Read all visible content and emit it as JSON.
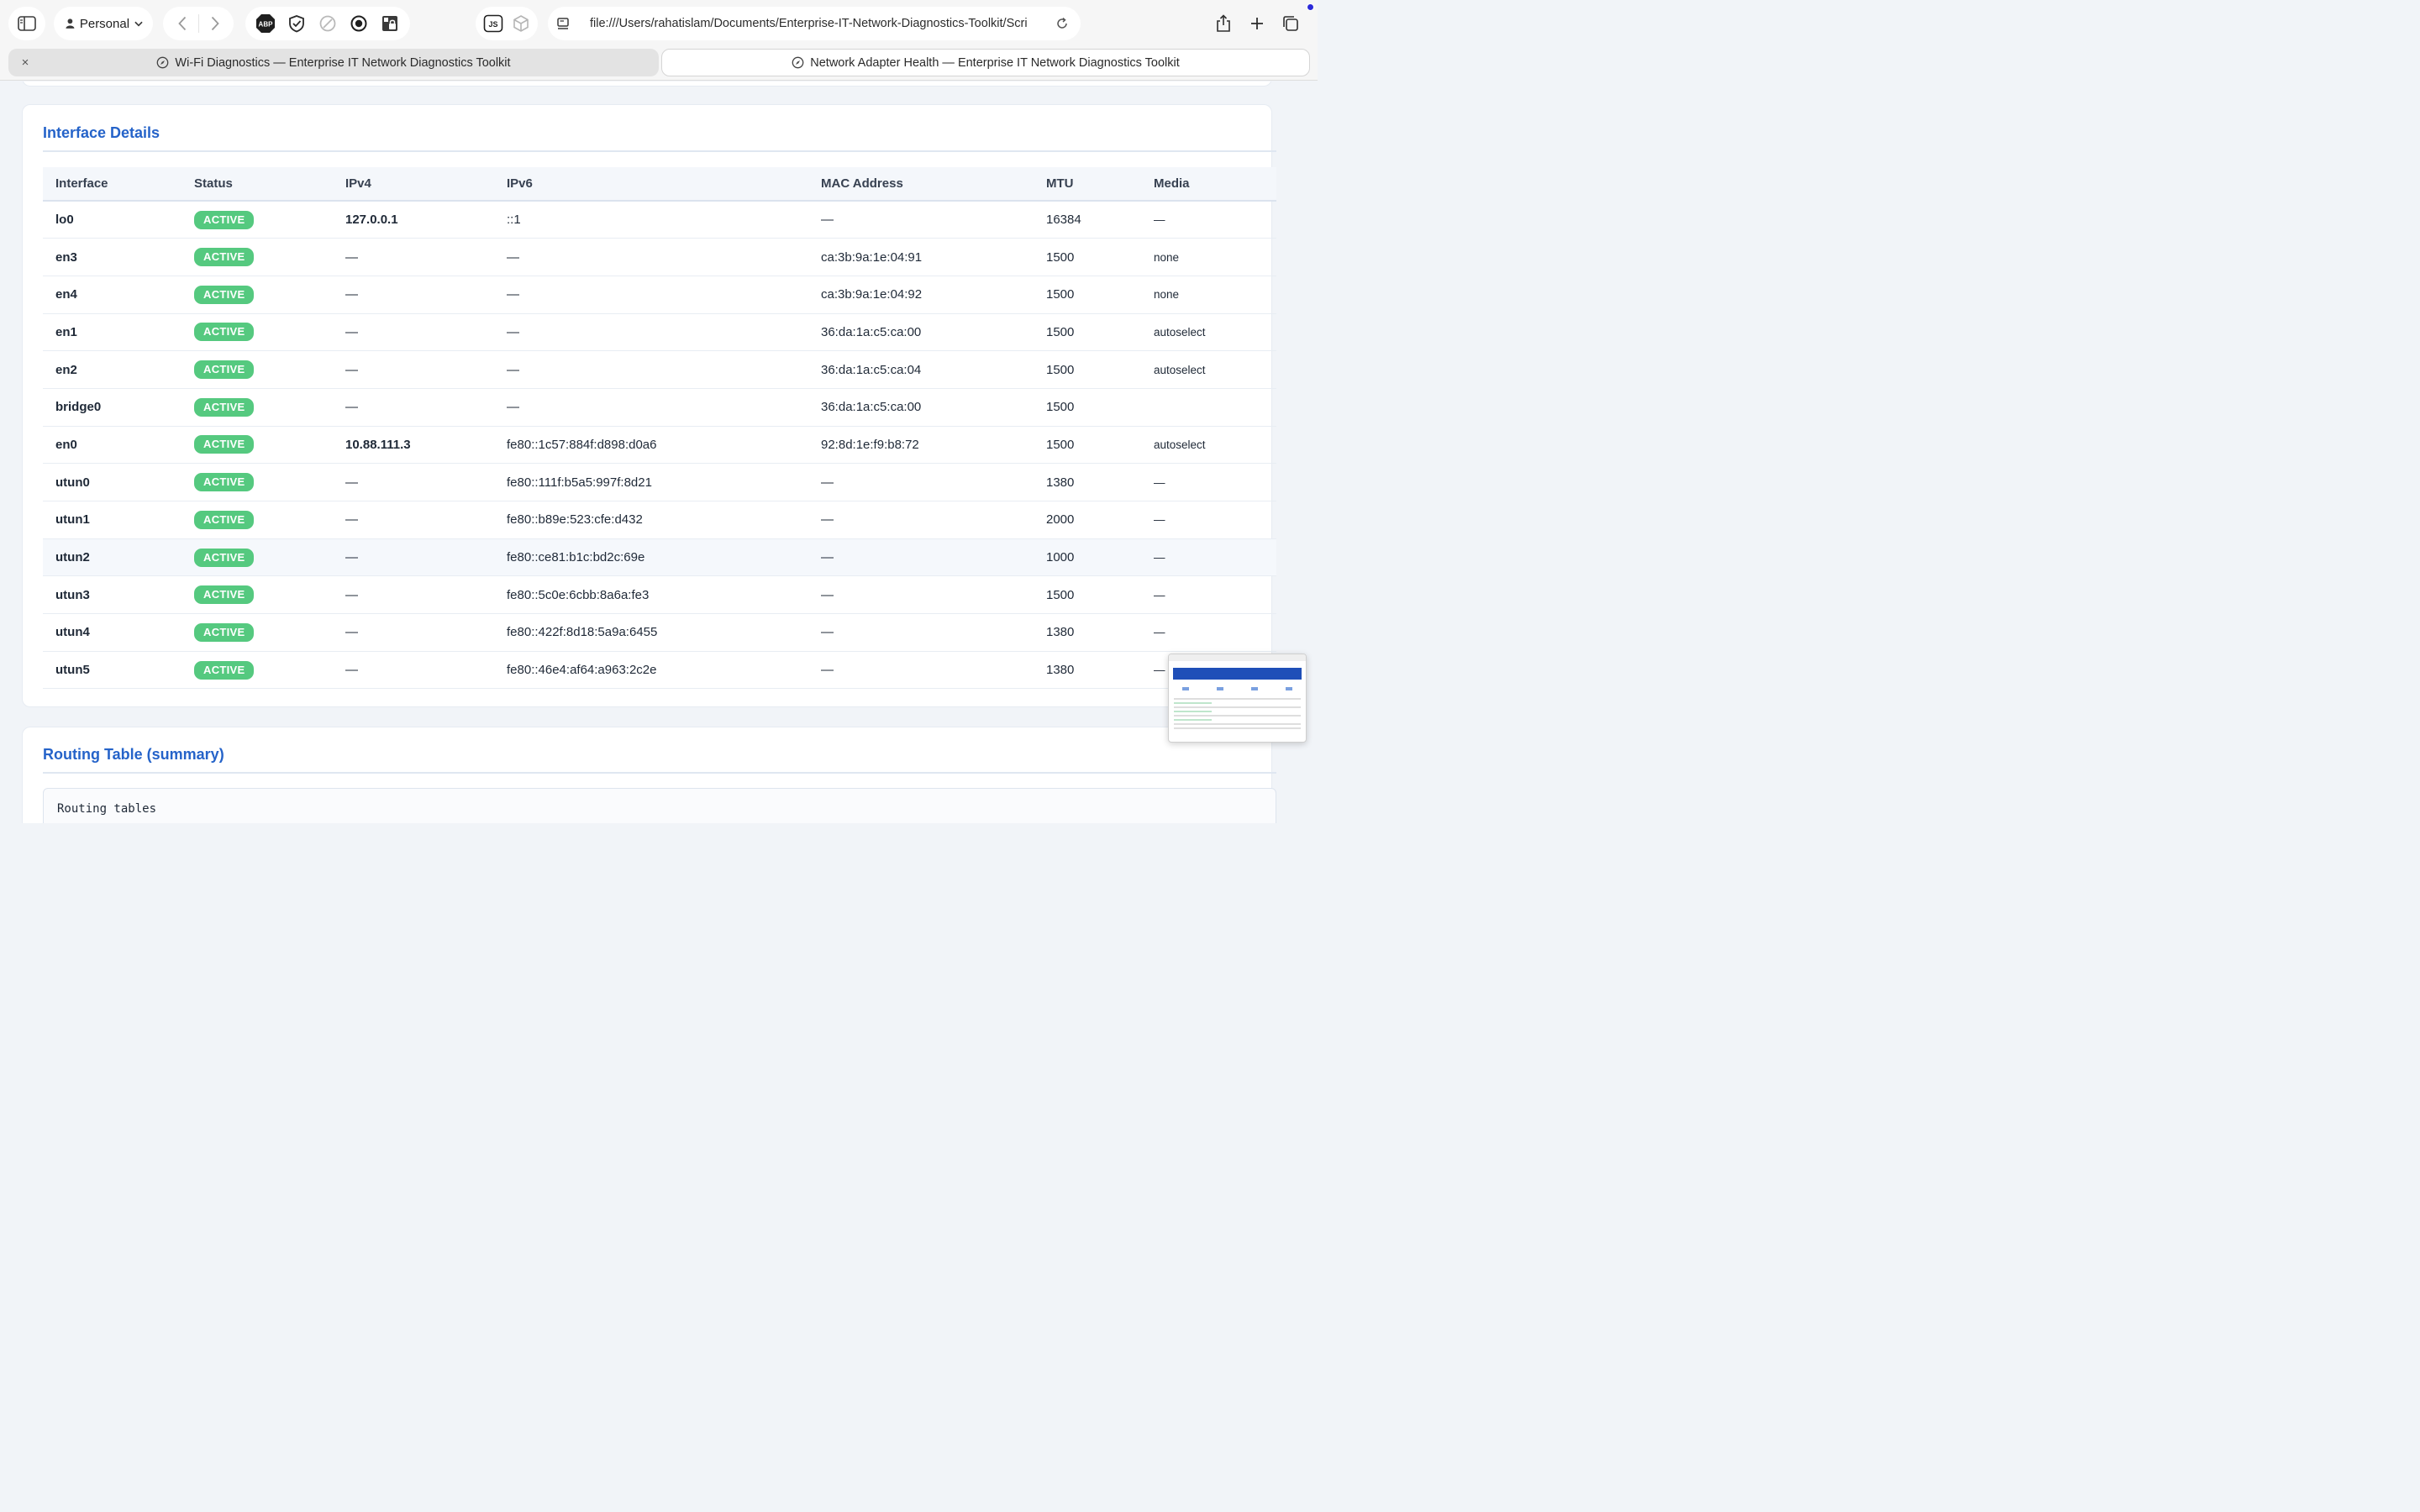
{
  "browser": {
    "profile_label": "Personal",
    "ext_abp_label": "ABP",
    "ext_js_label": "JS",
    "url": "file:///Users/rahatislam/Documents/Enterprise-IT-Network-Diagnostics-Toolkit/Scri",
    "tabs": [
      {
        "title": "Wi-Fi Diagnostics — Enterprise IT Network Diagnostics Toolkit",
        "active": false
      },
      {
        "title": "Network Adapter Health — Enterprise IT Network Diagnostics Toolkit",
        "active": true
      }
    ],
    "close_glyph": "×"
  },
  "interface_section": {
    "title": "Interface Details",
    "columns": [
      "Interface",
      "Status",
      "IPv4",
      "IPv6",
      "MAC Address",
      "MTU",
      "Media"
    ],
    "rows": [
      {
        "name": "lo0",
        "status": "ACTIVE",
        "ipv4": "127.0.0.1",
        "ipv6": "::1",
        "mac": "—",
        "mtu": "16384",
        "media": "—"
      },
      {
        "name": "en3",
        "status": "ACTIVE",
        "ipv4": "—",
        "ipv6": "—",
        "mac": "ca:3b:9a:1e:04:91",
        "mtu": "1500",
        "media": "none"
      },
      {
        "name": "en4",
        "status": "ACTIVE",
        "ipv4": "—",
        "ipv6": "—",
        "mac": "ca:3b:9a:1e:04:92",
        "mtu": "1500",
        "media": "none"
      },
      {
        "name": "en1",
        "status": "ACTIVE",
        "ipv4": "—",
        "ipv6": "—",
        "mac": "36:da:1a:c5:ca:00",
        "mtu": "1500",
        "media": "autoselect"
      },
      {
        "name": "en2",
        "status": "ACTIVE",
        "ipv4": "—",
        "ipv6": "—",
        "mac": "36:da:1a:c5:ca:04",
        "mtu": "1500",
        "media": "autoselect"
      },
      {
        "name": "bridge0",
        "status": "ACTIVE",
        "ipv4": "—",
        "ipv6": "—",
        "mac": "36:da:1a:c5:ca:00",
        "mtu": "1500",
        "media": ""
      },
      {
        "name": "en0",
        "status": "ACTIVE",
        "ipv4": "10.88.111.3",
        "ipv6": "fe80::1c57:884f:d898:d0a6",
        "mac": "92:8d:1e:f9:b8:72",
        "mtu": "1500",
        "media": "autoselect"
      },
      {
        "name": "utun0",
        "status": "ACTIVE",
        "ipv4": "—",
        "ipv6": "fe80::111f:b5a5:997f:8d21",
        "mac": "—",
        "mtu": "1380",
        "media": "—"
      },
      {
        "name": "utun1",
        "status": "ACTIVE",
        "ipv4": "—",
        "ipv6": "fe80::b89e:523:cfe:d432",
        "mac": "—",
        "mtu": "2000",
        "media": "—"
      },
      {
        "name": "utun2",
        "status": "ACTIVE",
        "ipv4": "—",
        "ipv6": "fe80::ce81:b1c:bd2c:69e",
        "mac": "—",
        "mtu": "1000",
        "media": "—"
      },
      {
        "name": "utun3",
        "status": "ACTIVE",
        "ipv4": "—",
        "ipv6": "fe80::5c0e:6cbb:8a6a:fe3",
        "mac": "—",
        "mtu": "1500",
        "media": "—"
      },
      {
        "name": "utun4",
        "status": "ACTIVE",
        "ipv4": "—",
        "ipv6": "fe80::422f:8d18:5a9a:6455",
        "mac": "—",
        "mtu": "1380",
        "media": "—"
      },
      {
        "name": "utun5",
        "status": "ACTIVE",
        "ipv4": "—",
        "ipv6": "fe80::46e4:af64:a963:2c2e",
        "mac": "—",
        "mtu": "1380",
        "media": "—"
      }
    ]
  },
  "routing_section": {
    "title": "Routing Table (summary)",
    "content": "Routing tables"
  },
  "colors": {
    "accent": "#2563c9",
    "badge_active": "#55c97f",
    "notification_dot": "#2b2ad8"
  }
}
